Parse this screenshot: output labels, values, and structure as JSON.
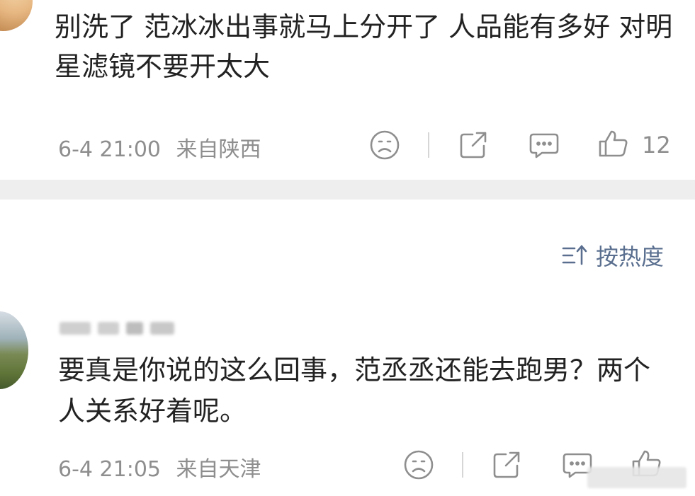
{
  "comment1": {
    "text": "别洗了 范冰冰出事就马上分开了 人品能有多好 对明星滤镜不要开太大",
    "time": "6-4 21:00",
    "location": "来自陕西",
    "likes": "12"
  },
  "sort": {
    "label": "按热度",
    "icon": "sort-icon"
  },
  "comment2": {
    "text": "要真是你说的这么回事，范丞丞还能去跑男？两个人关系好着呢。",
    "time": "6-4 21:05",
    "location": "来自天津"
  },
  "icons": [
    "frown-icon",
    "share-icon",
    "comment-icon",
    "like-icon"
  ],
  "colors": {
    "text": "#222222",
    "meta": "#8e8e8e",
    "accent": "#5a6f8f",
    "divider": "#eeeeee"
  }
}
